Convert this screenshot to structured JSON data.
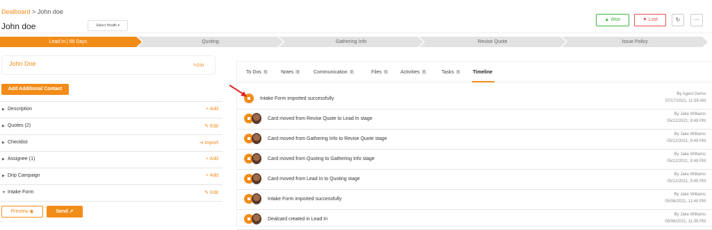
{
  "header": {
    "breadcrumb_link": "Dealboard",
    "breadcrumb_sep": ">",
    "breadcrumb_current": "John doe",
    "title": "John doe",
    "health_select": "Select Health",
    "won_label": "Won",
    "lost_label": "Lost"
  },
  "stages": [
    {
      "label": "Lead In | 66 Days",
      "active": true
    },
    {
      "label": "Quoting",
      "active": false
    },
    {
      "label": "Gathering Info",
      "active": false
    },
    {
      "label": "Revise Quote",
      "active": false
    },
    {
      "label": "Issue Policy",
      "active": false
    }
  ],
  "contact": {
    "name": "John Doe",
    "edit_label": "Edit",
    "add_contact_label": "Add Additional Contact"
  },
  "sections": [
    {
      "label": "Description",
      "action": "Add",
      "icon": "plus-icon"
    },
    {
      "label": "Quotes (2)",
      "action": "Edit",
      "icon": "pencil-icon"
    },
    {
      "label": "Checklist",
      "action": "Import",
      "icon": "import-icon"
    },
    {
      "label": "Assignee (1)",
      "action": "Add",
      "icon": "plus-icon"
    },
    {
      "label": "Drip Campaign",
      "action": "Add",
      "icon": "plus-icon"
    },
    {
      "label": "Intake Form",
      "action": "Edit",
      "icon": "pencil-icon"
    }
  ],
  "footer": {
    "preview_label": "Preview",
    "send_label": "Send"
  },
  "tabs": [
    {
      "label": "To Dos",
      "count": "0"
    },
    {
      "label": "Notes",
      "count": "0"
    },
    {
      "label": "Communication",
      "count": "0"
    },
    {
      "label": "Files",
      "count": "0"
    },
    {
      "label": "Activities",
      "count": "0"
    },
    {
      "label": "Tasks",
      "count": "0"
    },
    {
      "label": "Timeline",
      "count": ""
    }
  ],
  "timeline": [
    {
      "text": "Intake Form imported successfully",
      "by": "By Agent Demo",
      "date": "07/17/2021, 11:59 AM",
      "avatar": false
    },
    {
      "text": "Card moved from Revise Quote to Lead In stage",
      "by": "By Jake Williams",
      "date": "05/12/2021, 9:49 PM",
      "avatar": true
    },
    {
      "text": "Card moved from Gathering Info to Revise Quote stage",
      "by": "By Jake Williams",
      "date": "05/12/2021, 9:49 PM",
      "avatar": true
    },
    {
      "text": "Card moved from Quoting to Gathering Info stage",
      "by": "By Jake Williams",
      "date": "05/12/2021, 9:49 PM",
      "avatar": true
    },
    {
      "text": "Card moved from Lead In to Quoting stage",
      "by": "By Jake Williams",
      "date": "05/12/2021, 9:49 PM",
      "avatar": true
    },
    {
      "text": "Intake Form imported successfully",
      "by": "By Jake Williams",
      "date": "05/06/2021, 11:40 PM",
      "avatar": true
    },
    {
      "text": "Dealcard created in Lead In",
      "by": "By Jake Williams",
      "date": "05/06/2021, 11:39 PM",
      "avatar": true
    }
  ],
  "colors": {
    "accent": "#f28c18",
    "stage_inactive": "#e2e2e2",
    "won": "#3fb13f",
    "lost": "#e84a4a",
    "annotation_arrow": "#e02020"
  }
}
